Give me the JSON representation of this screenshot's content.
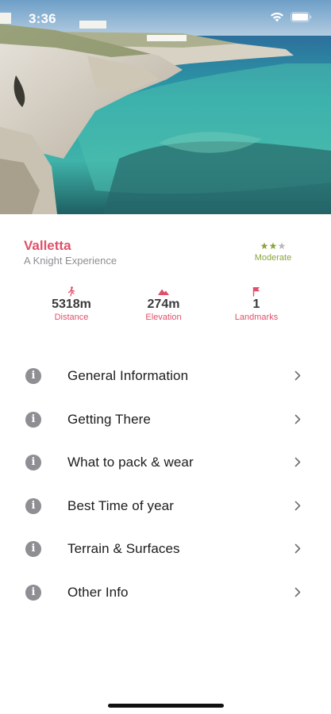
{
  "status_bar": {
    "time": "3:36",
    "icons": [
      "wifi-icon",
      "battery-icon"
    ]
  },
  "hero": {
    "image": "coastal-cliffs-photo"
  },
  "route": {
    "title": "Valletta",
    "subtitle": "A Knight Experience",
    "difficulty": {
      "label": "Moderate",
      "rating": 2,
      "max": 3
    }
  },
  "stats": [
    {
      "icon": "walker-icon",
      "value": "5318m",
      "label": "Distance"
    },
    {
      "icon": "mountain-icon",
      "value": "274m",
      "label": "Elevation"
    },
    {
      "icon": "flag-icon",
      "value": "1",
      "label": "Landmarks"
    }
  ],
  "menu": [
    {
      "label": "General Information",
      "icon": "info-icon"
    },
    {
      "label": "Getting There",
      "icon": "info-icon"
    },
    {
      "label": "What to pack & wear",
      "icon": "info-icon"
    },
    {
      "label": "Best Time of year",
      "icon": "info-icon"
    },
    {
      "label": "Terrain & Surfaces",
      "icon": "info-icon"
    },
    {
      "label": "Other Info",
      "icon": "info-icon"
    }
  ],
  "colors": {
    "accent": "#e0506a",
    "difficulty": "#8aa53b",
    "info_icon": "#8e8e93",
    "star_empty": "#b9b9b9"
  }
}
